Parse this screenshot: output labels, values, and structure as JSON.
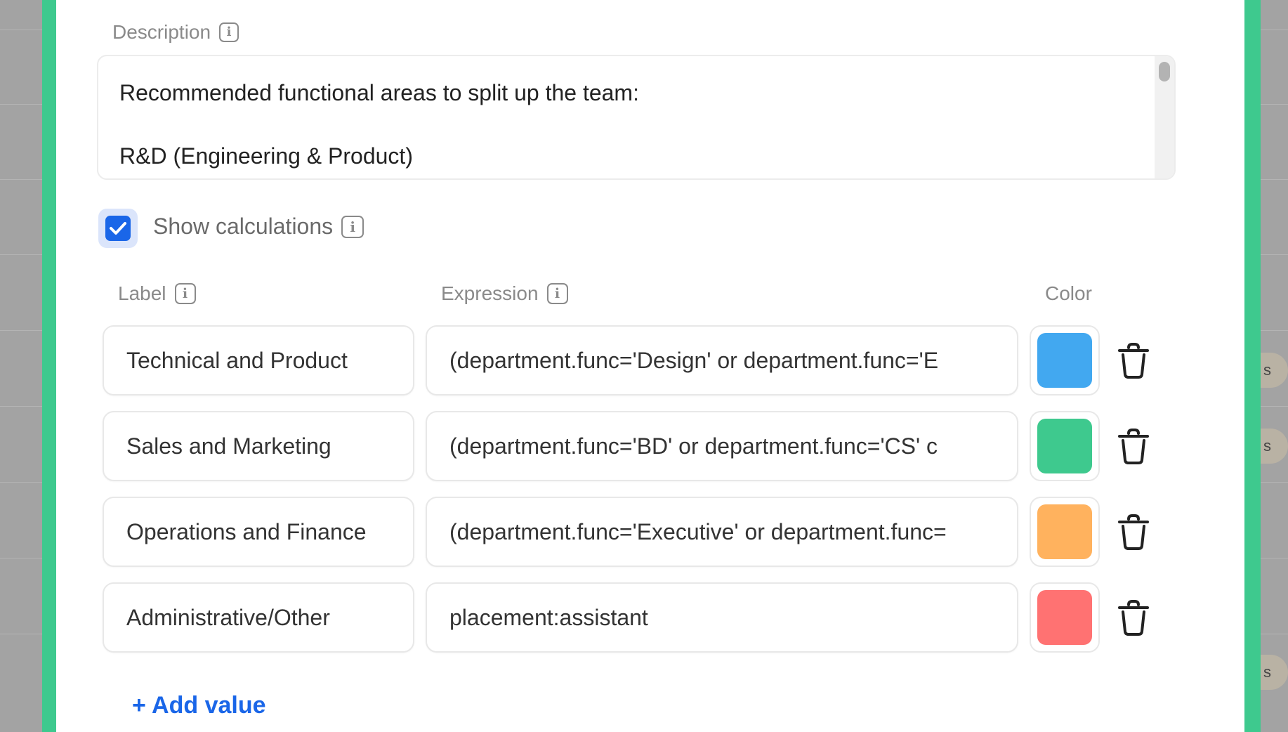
{
  "form": {
    "description_label": "Description",
    "description_text": [
      "Recommended functional areas to split up the team:",
      "R&D (Engineering & Product)"
    ],
    "show_calculations_label": "Show calculations",
    "show_calculations_checked": true,
    "columns": {
      "label": "Label",
      "expression": "Expression",
      "color": "Color"
    },
    "rows": [
      {
        "label": "Technical and Product",
        "expression": "(department.func='Design' or department.func='E",
        "color": "#42a8f0"
      },
      {
        "label": "Sales and Marketing",
        "expression": "(department.func='BD' or department.func='CS' c",
        "color": "#3ec98e"
      },
      {
        "label": "Operations and Finance",
        "expression": "(department.func='Executive' or department.func=",
        "color": "#ffb25e"
      },
      {
        "label": "Administrative/Other",
        "expression": "placement:assistant",
        "color": "#ff7272"
      }
    ],
    "add_value_label": "+ Add value"
  },
  "background": {
    "pill_letter": "s"
  },
  "colors": {
    "accent": "#1a66e8",
    "frame_green": "#3ec98e"
  }
}
